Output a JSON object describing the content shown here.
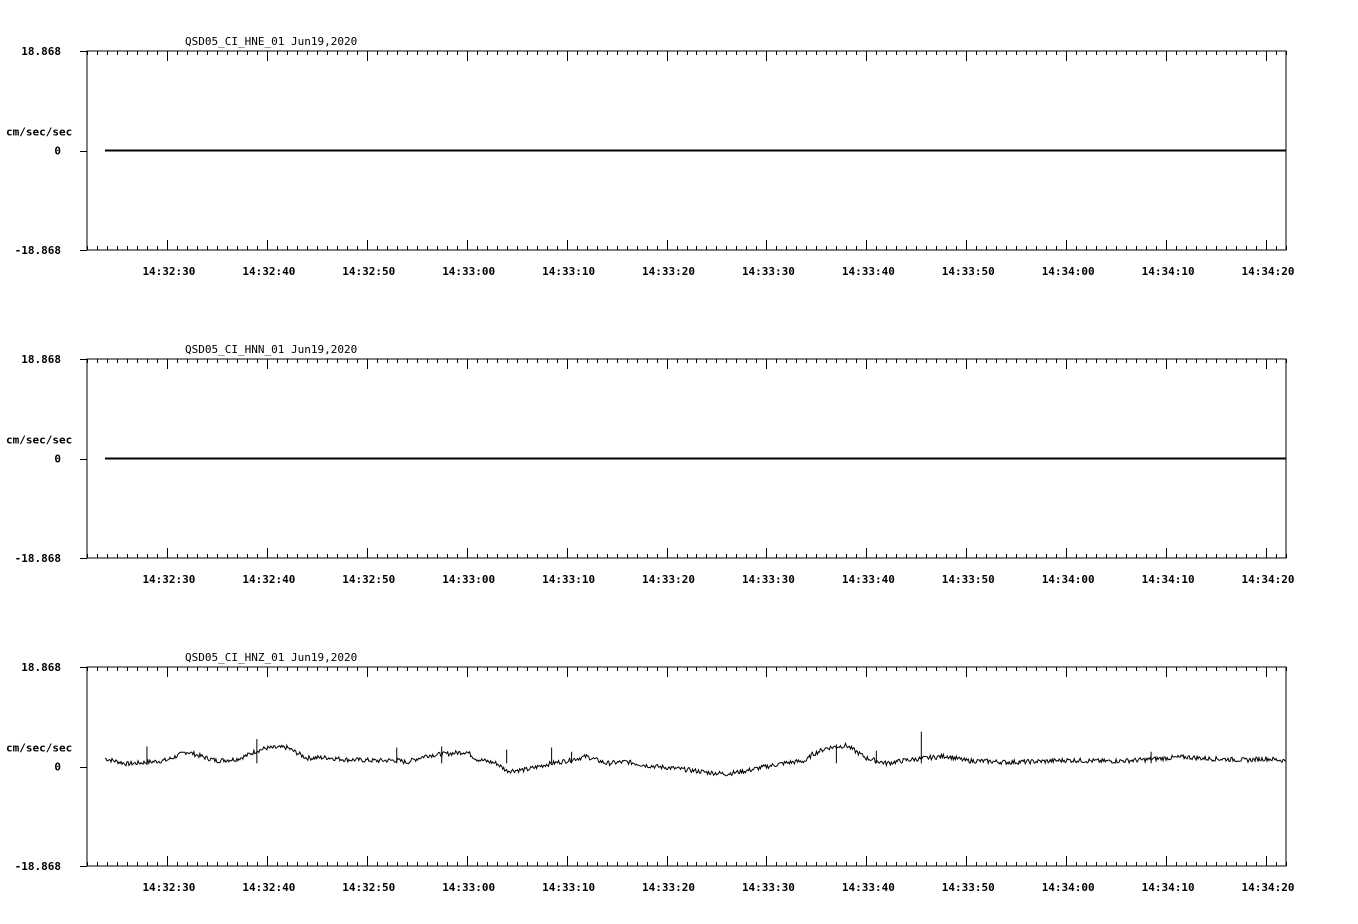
{
  "chart_data": [
    {
      "type": "line",
      "title": "QSD05_CI_HNE_01  Jun19,2020",
      "ylabel": "cm/sec/sec",
      "ylim": [
        -18.868,
        18.868
      ],
      "y_tick_labels": [
        "18.868",
        "0",
        "-18.868"
      ],
      "x_tick_labels": [
        "14:32:30",
        "14:32:40",
        "14:32:50",
        "14:33:00",
        "14:33:10",
        "14:33:20",
        "14:33:30",
        "14:33:40",
        "14:33:50",
        "14:34:00",
        "14:34:10",
        "14:34:20"
      ],
      "x_range_seconds": [
        -8,
        112
      ],
      "trace_start_seconds": -6.2,
      "series": [
        {
          "x_seconds": [
            -6.2,
            112
          ],
          "values": [
            0,
            0
          ]
        }
      ]
    },
    {
      "type": "line",
      "title": "QSD05_CI_HNN_01  Jun19,2020",
      "ylabel": "cm/sec/sec",
      "ylim": [
        -18.868,
        18.868
      ],
      "y_tick_labels": [
        "18.868",
        "0",
        "-18.868"
      ],
      "x_tick_labels": [
        "14:32:30",
        "14:32:40",
        "14:32:50",
        "14:33:00",
        "14:33:10",
        "14:33:20",
        "14:33:30",
        "14:33:40",
        "14:33:50",
        "14:34:00",
        "14:34:10",
        "14:34:20"
      ],
      "x_range_seconds": [
        -8,
        112
      ],
      "trace_start_seconds": -6.2,
      "series": [
        {
          "x_seconds": [
            -6.2,
            112
          ],
          "values": [
            0,
            0
          ]
        }
      ]
    },
    {
      "type": "line",
      "title": "QSD05_CI_HNZ_01  Jun19,2020",
      "ylabel": "cm/sec/sec",
      "ylim": [
        -18.868,
        18.868
      ],
      "y_tick_labels": [
        "18.868",
        "0",
        "-18.868"
      ],
      "x_tick_labels": [
        "14:32:30",
        "14:32:40",
        "14:32:50",
        "14:33:00",
        "14:33:10",
        "14:33:20",
        "14:33:30",
        "14:33:40",
        "14:33:50",
        "14:34:00",
        "14:34:10",
        "14:34:20"
      ],
      "x_range_seconds": [
        -8,
        112
      ],
      "trace_start_seconds": -6.2,
      "series": [
        {
          "x_seconds": [
            -6.2,
            -4.0,
            -2.0,
            0.0,
            2.0,
            4.0,
            5.0,
            7.0,
            8.0,
            9.0,
            10.0,
            12.0,
            14.0,
            16.0,
            18.0,
            20.0,
            21.0,
            23.0,
            24.0,
            26.0,
            28.0,
            30.0,
            31.0,
            33.0,
            34.0,
            36.0,
            38.0,
            40.0,
            42.0,
            44.0,
            46.0,
            48.0,
            50.0,
            52.0,
            54.0,
            56.0,
            58.0,
            60.0,
            62.0,
            64.0,
            64.5,
            66.0,
            68.0,
            70.0,
            72.0,
            74.0,
            76.0,
            78.0,
            80.0,
            82.0,
            84.0,
            86.0,
            88.0,
            90.0,
            92.0,
            94.0,
            96.0,
            98.0,
            100.0,
            102.0,
            104.0,
            106.0,
            108.0,
            110.0,
            112.0
          ],
          "values": [
            1.5,
            0.5,
            0.8,
            1.2,
            2.8,
            1.6,
            1.1,
            1.4,
            2.1,
            3.0,
            3.5,
            3.6,
            1.6,
            1.7,
            1.3,
            1.2,
            1.1,
            1.2,
            0.8,
            2.1,
            2.4,
            2.8,
            1.4,
            0.6,
            -0.8,
            -0.6,
            0.4,
            1.1,
            1.9,
            0.6,
            0.9,
            0.2,
            -0.2,
            -0.6,
            -1.1,
            -1.4,
            -0.8,
            0.0,
            0.7,
            1.1,
            2.2,
            3.5,
            4.0,
            1.6,
            0.6,
            1.2,
            1.6,
            2.0,
            1.1,
            1.0,
            0.8,
            0.9,
            1.0,
            1.2,
            1.1,
            1.0,
            1.1,
            1.3,
            1.6,
            1.8,
            1.5,
            1.4,
            1.2,
            1.5,
            1.1
          ]
        }
      ],
      "spikes": [
        {
          "x_seconds": -2.0,
          "value": 3.8
        },
        {
          "x_seconds": 9.0,
          "value": 5.2
        },
        {
          "x_seconds": 23.0,
          "value": 3.6
        },
        {
          "x_seconds": 27.5,
          "value": 3.8
        },
        {
          "x_seconds": 34.0,
          "value": 3.2
        },
        {
          "x_seconds": 38.5,
          "value": 3.6
        },
        {
          "x_seconds": 40.5,
          "value": 2.8
        },
        {
          "x_seconds": 67.0,
          "value": 4.2
        },
        {
          "x_seconds": 71.0,
          "value": 3.0
        },
        {
          "x_seconds": 75.5,
          "value": 6.6
        },
        {
          "x_seconds": 98.5,
          "value": 2.8
        }
      ]
    }
  ]
}
